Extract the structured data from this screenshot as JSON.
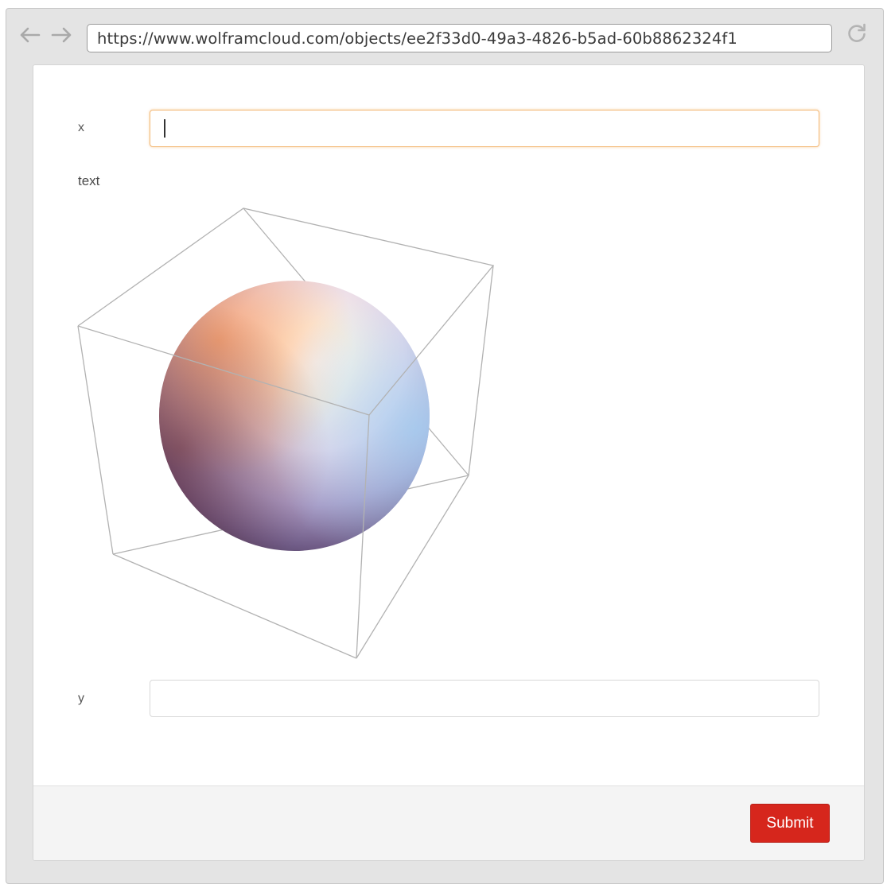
{
  "browser": {
    "url": "https://www.wolframcloud.com/objects/ee2f33d0-49a3-4826-b5ad-60b8862324f1",
    "icons": [
      "back-arrow-icon",
      "forward-arrow-icon",
      "reload-icon"
    ]
  },
  "form": {
    "fields": [
      {
        "label": "x",
        "value": "",
        "focused": true
      },
      {
        "label": "y",
        "value": "",
        "focused": false
      }
    ],
    "output_label": "text",
    "graphic": "3D sphere inside a bounding box",
    "submit_label": "Submit"
  },
  "colors": {
    "focus_border": "#f3b977",
    "submit_button": "#d6261c",
    "footer_background": "#f4f4f4"
  }
}
